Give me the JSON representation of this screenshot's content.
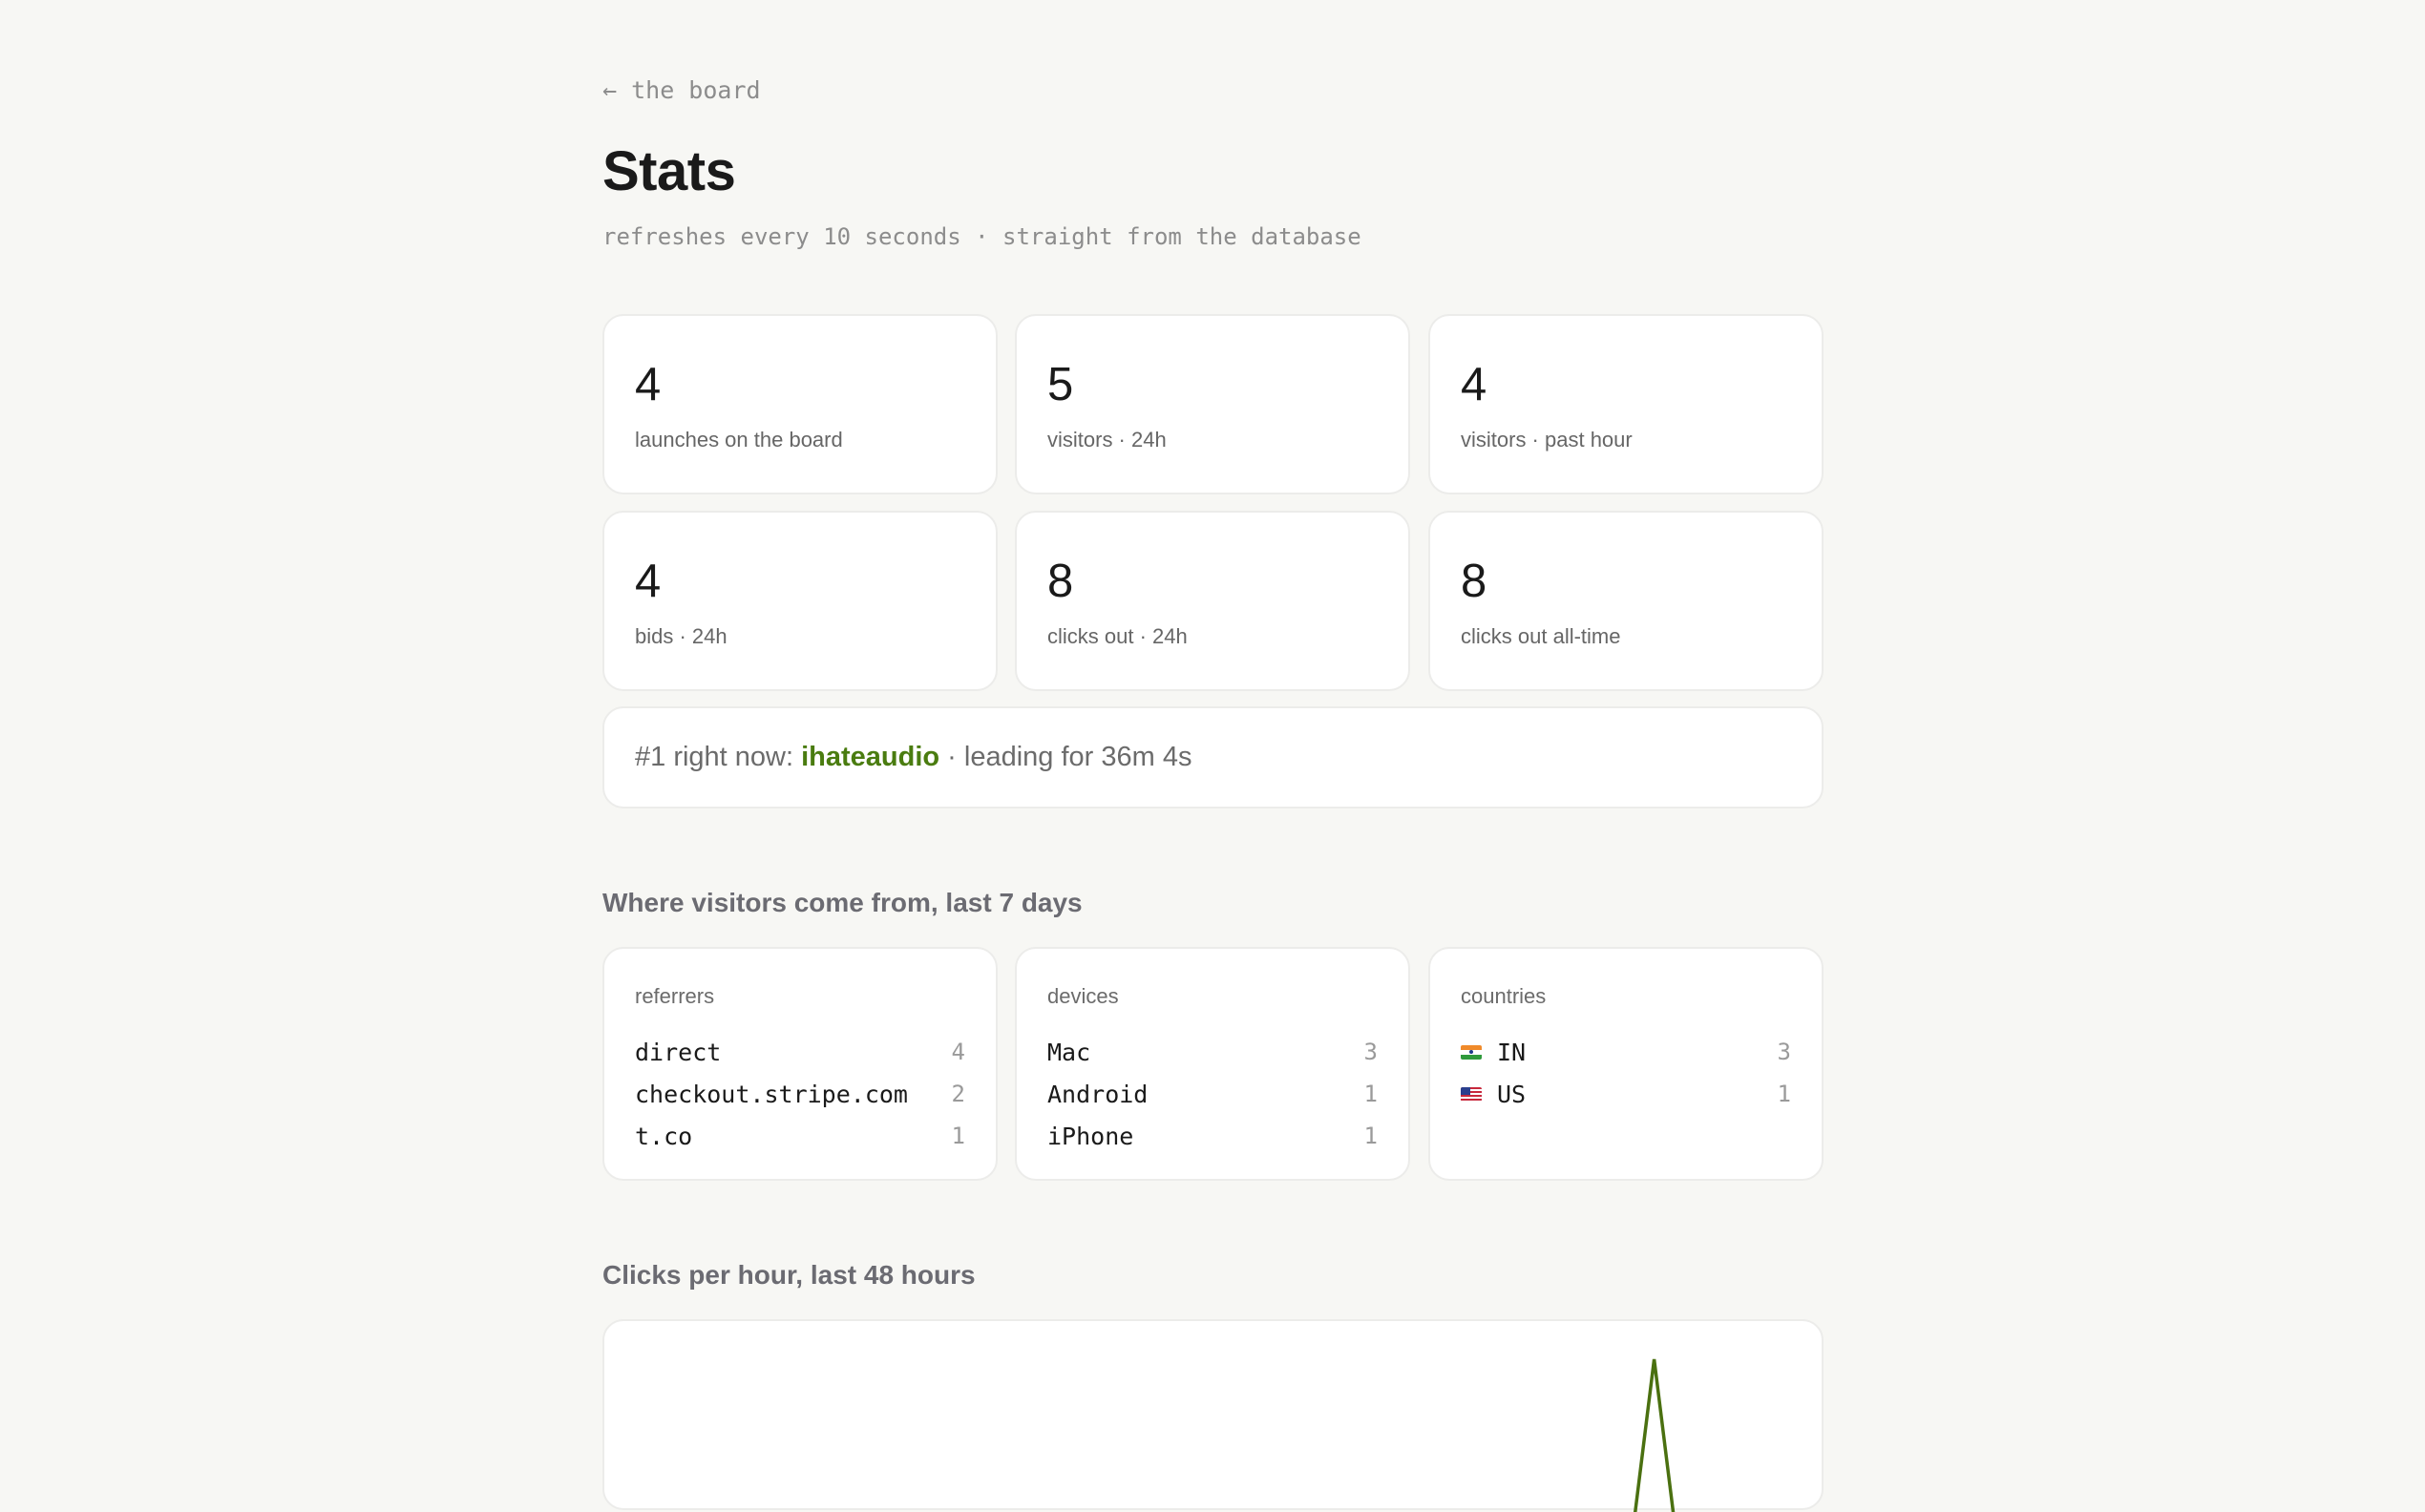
{
  "header": {
    "back_link": "← the board",
    "title": "Stats",
    "subtitle": "refreshes every 10 seconds · straight from the database"
  },
  "stats": [
    {
      "value": "4",
      "label": "launches on the board"
    },
    {
      "value": "5",
      "label": "visitors · 24h"
    },
    {
      "value": "4",
      "label": "visitors · past hour"
    },
    {
      "value": "4",
      "label": "bids · 24h"
    },
    {
      "value": "8",
      "label": "clicks out · 24h"
    },
    {
      "value": "8",
      "label": "clicks out all-time"
    }
  ],
  "leader": {
    "prefix": "#1 right now: ",
    "name": "ihateaudio",
    "suffix": " · leading for 36m 4s"
  },
  "sources": {
    "title": "Where visitors come from, last 7 days",
    "referrers": {
      "title": "referrers",
      "items": [
        {
          "name": "direct",
          "count": "4"
        },
        {
          "name": "checkout.stripe.com",
          "count": "2"
        },
        {
          "name": "t.co",
          "count": "1"
        }
      ]
    },
    "devices": {
      "title": "devices",
      "items": [
        {
          "name": "Mac",
          "count": "3"
        },
        {
          "name": "Android",
          "count": "1"
        },
        {
          "name": "iPhone",
          "count": "1"
        }
      ]
    },
    "countries": {
      "title": "countries",
      "items": [
        {
          "name": "IN",
          "count": "3",
          "flag": "india-flag-icon"
        },
        {
          "name": "US",
          "count": "1",
          "flag": "us-flag-icon"
        }
      ]
    }
  },
  "clicks": {
    "title": "Clicks per hour, last 48 hours",
    "line_color": "#4a7010",
    "accent_color": "#4a7c10"
  },
  "chart_data": {
    "type": "line",
    "x": [
      1,
      2,
      3,
      4,
      5,
      6,
      7,
      8,
      9,
      10,
      11,
      12,
      13,
      14,
      15,
      16,
      17,
      18,
      19,
      20,
      21,
      22,
      23,
      24,
      25,
      26,
      27,
      28,
      29,
      30,
      31,
      32,
      33,
      34,
      35,
      36,
      37,
      38,
      39,
      40,
      41,
      42,
      43,
      44,
      45,
      46,
      47,
      48
    ],
    "series": [
      {
        "values": [
          0,
          0,
          0,
          0,
          0,
          0,
          0,
          0,
          0,
          0,
          0,
          0,
          0,
          0,
          0,
          0,
          0,
          0,
          0,
          0,
          0,
          0,
          0,
          0,
          0,
          0,
          0,
          0,
          0,
          0,
          0,
          0,
          0,
          0,
          0,
          0,
          0,
          0,
          0,
          0,
          0,
          0,
          8,
          0,
          0,
          0,
          0,
          0
        ]
      }
    ],
    "title": "",
    "xlabel": "",
    "ylabel": "",
    "ylim": [
      0,
      8
    ]
  }
}
